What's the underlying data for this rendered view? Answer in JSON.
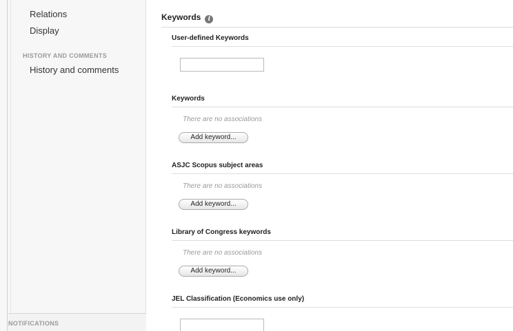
{
  "sidebar": {
    "links": [
      "Relations",
      "Display"
    ],
    "history_heading": "HISTORY AND COMMENTS",
    "history_link": "History and comments",
    "notifications_heading": "NOTIFICATIONS"
  },
  "main": {
    "section_title": "Keywords",
    "info_icon": "i",
    "user_defined": {
      "title": "User-defined Keywords",
      "value": ""
    },
    "groups": [
      {
        "title": "Keywords",
        "empty_text": "There are no associations",
        "button": "Add keyword..."
      },
      {
        "title": "ASJC Scopus subject areas",
        "empty_text": "There are no associations",
        "button": "Add keyword..."
      },
      {
        "title": "Library of Congress keywords",
        "empty_text": "There are no associations",
        "button": "Add keyword..."
      }
    ],
    "jel": {
      "title": "JEL Classification (Economics use only)",
      "value": ""
    }
  }
}
